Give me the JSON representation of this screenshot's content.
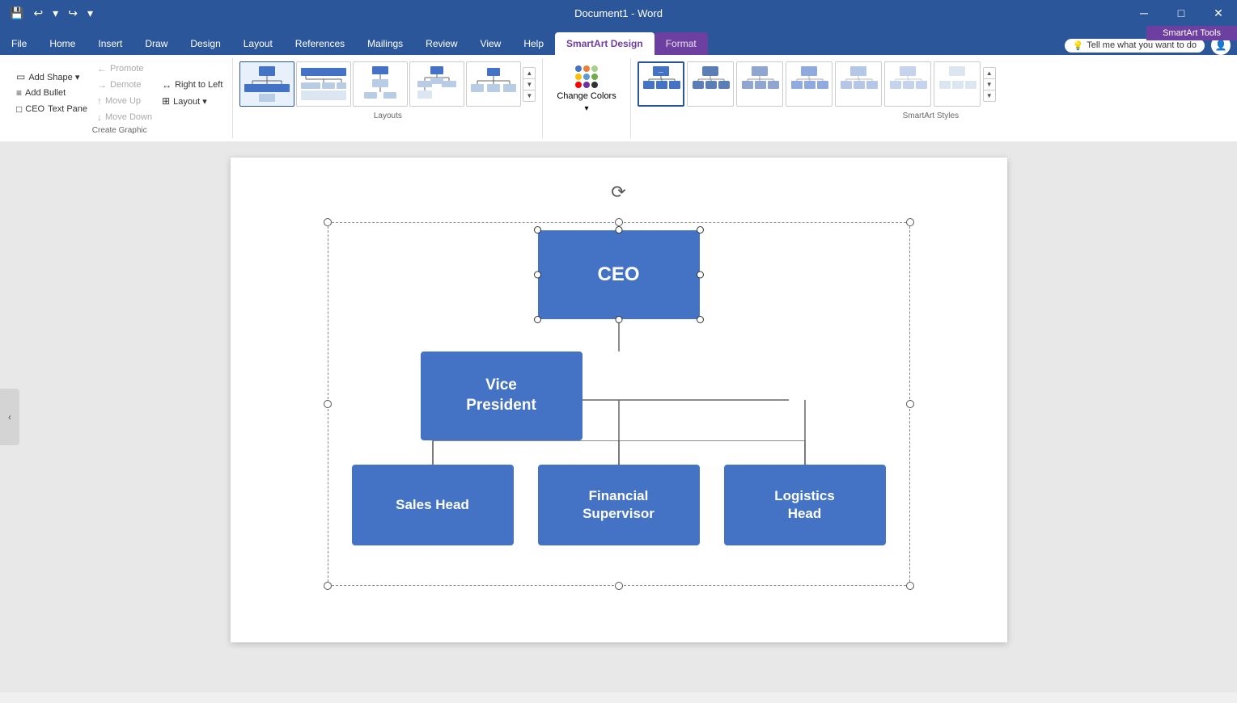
{
  "titleBar": {
    "title": "Document1 - Word",
    "appName": "Word"
  },
  "menuBar": {
    "items": [
      "File",
      "Home",
      "Insert",
      "Draw",
      "Design",
      "Layout",
      "References",
      "Mailings",
      "Review",
      "View",
      "Help"
    ]
  },
  "ribbon": {
    "activeTab": "SmartArt Design",
    "contextLabel": "SmartArt Tools",
    "tabs": [
      "File",
      "Home",
      "Insert",
      "Draw",
      "Design",
      "Layout",
      "References",
      "Mailings",
      "Review",
      "View",
      "Help",
      "SmartArt Design",
      "Format"
    ],
    "tellMe": "Tell me what you want to do",
    "groups": {
      "createGraphic": {
        "label": "Create Graphic",
        "buttons": [
          {
            "label": "Add Shape",
            "icon": "▭",
            "hasDropdown": true
          },
          {
            "label": "Add Bullet",
            "icon": "≡",
            "hasDropdown": false
          },
          {
            "label": "Text Pane",
            "icon": "□",
            "hasDropdown": false
          },
          {
            "label": "Promote",
            "icon": "←",
            "hasDropdown": false
          },
          {
            "label": "Demote",
            "icon": "→",
            "hasDropdown": false
          },
          {
            "label": "Right to Left",
            "icon": "↔",
            "hasDropdown": false
          },
          {
            "label": "Move Up",
            "icon": "↑",
            "hasDropdown": false
          },
          {
            "label": "Move Down",
            "icon": "↓",
            "hasDropdown": false
          },
          {
            "label": "Layout",
            "icon": "⊞",
            "hasDropdown": true
          }
        ]
      },
      "layouts": {
        "label": "Layouts",
        "items": [
          "hierarchy1",
          "hierarchy2",
          "hierarchy3",
          "hierarchy4",
          "hierarchy5"
        ]
      },
      "changeColors": {
        "label": "Change Colors",
        "dots": [
          "#4472c4",
          "#ed7d31",
          "#a9d18e",
          "#ffc000",
          "#5b9bd5",
          "#70ad47",
          "#ff0000",
          "#7030a0",
          "#000000"
        ]
      },
      "smartArtStyles": {
        "label": "SmartArt Styles",
        "items": [
          "style1",
          "style2",
          "style3",
          "style4",
          "style5",
          "style6"
        ]
      }
    }
  },
  "orgChart": {
    "nodes": {
      "ceo": "CEO",
      "vp": "Vice\nPresident",
      "salesHead": "Sales Head",
      "financialSupervisor": "Financial\nSupervisor",
      "logisticsHead": "Logistics\nHead"
    }
  }
}
